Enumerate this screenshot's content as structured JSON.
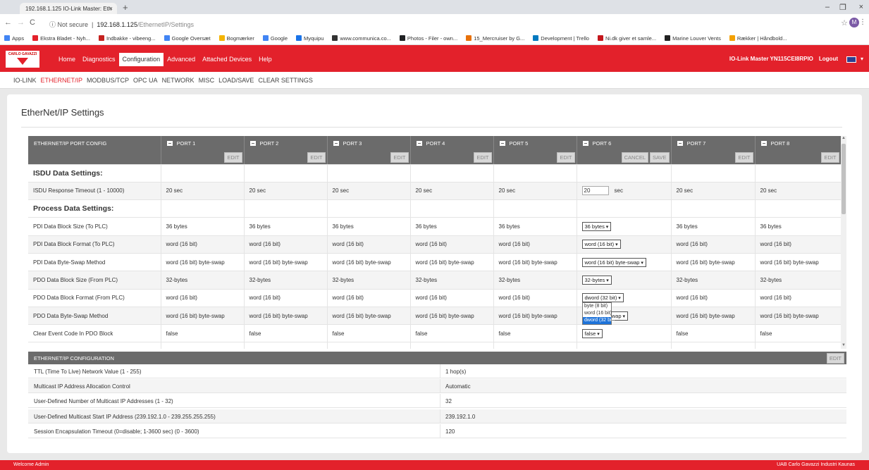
{
  "browser": {
    "tab_title": "192.168.1.125 IO-Link Master: Eth",
    "url_prefix": "Not secure",
    "url_host": "192.168.1.125",
    "url_path": "/EthernetIP/Settings",
    "avatar_letter": "M",
    "bookmarks": [
      "Apps",
      "Ekstra Bladet - Nyh...",
      "Indbakke - vibeeng...",
      "Google Oversæt",
      "Bogmærker",
      "Google",
      "Myquipu",
      "www.communica.co...",
      "Photos - Filer - own...",
      "15_Mercruiser by G...",
      "Development | Trello",
      "Ni.dk giver et samle...",
      "Marine Louver Vents",
      "Rækker | Håndbold..."
    ]
  },
  "app": {
    "logo_text": "CARLO GAVAZZI",
    "nav": [
      "Home",
      "Diagnostics",
      "Configuration",
      "Advanced",
      "Attached Devices",
      "Help"
    ],
    "nav_active": "Configuration",
    "device_name": "IO-Link Master YN115CEI8RPIO",
    "logout": "Logout",
    "subnav": [
      "IO-LINK",
      "ETHERNET/IP",
      "MODBUS/TCP",
      "OPC UA",
      "NETWORK",
      "MISC",
      "LOAD/SAVE",
      "CLEAR SETTINGS"
    ],
    "subnav_active": "ETHERNET/IP",
    "page_title": "EtherNet/IP Settings",
    "footer_left": "Welcome Admin",
    "footer_right": "UAB Carlo Gavazzi Industri Kaunas"
  },
  "port_config": {
    "header": "ETHERNET/IP PORT CONFIG",
    "ports": [
      "PORT 1",
      "PORT 2",
      "PORT 3",
      "PORT 4",
      "PORT 5",
      "PORT 6",
      "PORT 7",
      "PORT 8"
    ],
    "edit_label": "EDIT",
    "cancel_label": "CANCEL",
    "save_label": "SAVE",
    "editing_port_index": 5,
    "rows": [
      {
        "type": "section",
        "label": "ISDU Data Settings:"
      },
      {
        "type": "data",
        "label": "ISDU Response Timeout (1 - 10000)",
        "values": [
          "20 sec",
          "20 sec",
          "20 sec",
          "20 sec",
          "20 sec",
          "20",
          "20 sec",
          "20 sec"
        ],
        "edit_unit": "sec"
      },
      {
        "type": "section",
        "label": "Process Data Settings:"
      },
      {
        "type": "data",
        "label": "PDI Data Block Size (To PLC)",
        "values": [
          "36 bytes",
          "36 bytes",
          "36 bytes",
          "36 bytes",
          "36 bytes",
          "36 bytes",
          "36 bytes",
          "36 bytes"
        ]
      },
      {
        "type": "data",
        "label": "PDI Data Block Format (To PLC)",
        "values": [
          "word (16 bit)",
          "word (16 bit)",
          "word (16 bit)",
          "word (16 bit)",
          "word (16 bit)",
          "word (16 bit)",
          "word (16 bit)",
          "word (16 bit)"
        ]
      },
      {
        "type": "data",
        "label": "PDI Data Byte-Swap Method",
        "values": [
          "word (16 bit) byte-swap",
          "word (16 bit) byte-swap",
          "word (16 bit) byte-swap",
          "word (16 bit) byte-swap",
          "word (16 bit) byte-swap",
          "word (16 bit) byte-swap",
          "word (16 bit) byte-swap",
          "word (16 bit) byte-swap"
        ]
      },
      {
        "type": "data",
        "label": "PDO Data Block Size (From PLC)",
        "values": [
          "32-bytes",
          "32-bytes",
          "32-bytes",
          "32-bytes",
          "32-bytes",
          "32-bytes",
          "32-bytes",
          "32-bytes"
        ]
      },
      {
        "type": "data",
        "label": "PDO Data Block Format (From PLC)",
        "values": [
          "word (16 bit)",
          "word (16 bit)",
          "word (16 bit)",
          "word (16 bit)",
          "word (16 bit)",
          "dword (32 bit)",
          "word (16 bit)",
          "word (16 bit)"
        ]
      },
      {
        "type": "data",
        "label": "PDO Data Byte-Swap Method",
        "values": [
          "word (16 bit) byte-swap",
          "word (16 bit) byte-swap",
          "word (16 bit) byte-swap",
          "word (16 bit) byte-swap",
          "word (16 bit) byte-swap",
          "-swap",
          "word (16 bit) byte-swap",
          "word (16 bit) byte-swap"
        ]
      },
      {
        "type": "data",
        "label": "Clear Event Code In PDO Block",
        "values": [
          "false",
          "false",
          "false",
          "false",
          "false",
          "false",
          "false",
          "false"
        ]
      }
    ],
    "dropdown_open": {
      "options": [
        "byte (8 bit)",
        "word (16 bit)",
        "dword (32 bit)"
      ],
      "highlighted": "dword (32 bit)"
    }
  },
  "eip_config": {
    "header": "ETHERNET/IP CONFIGURATION",
    "edit_label": "EDIT",
    "rows": [
      {
        "label": "TTL (Time To Live) Network Value (1 - 255)",
        "value": "1 hop(s)"
      },
      {
        "label": "Multicast IP Address Allocation Control",
        "value": "Automatic"
      },
      {
        "label": "User-Defined Number of Multicast IP Addresses (1 - 32)",
        "value": "32"
      },
      {
        "label": "User-Defined Multicast Start IP Address (239.192.1.0 - 239.255.255.255)",
        "value": "239.192.1.0"
      },
      {
        "label": "Session Encapsulation Timeout (0=disable; 1-3600 sec) (0 - 3600)",
        "value": "120"
      }
    ]
  },
  "colors": {
    "brand_red": "#e3212b",
    "header_gray": "#6b6b6b",
    "dropdown_highlight": "#1e73d9"
  }
}
